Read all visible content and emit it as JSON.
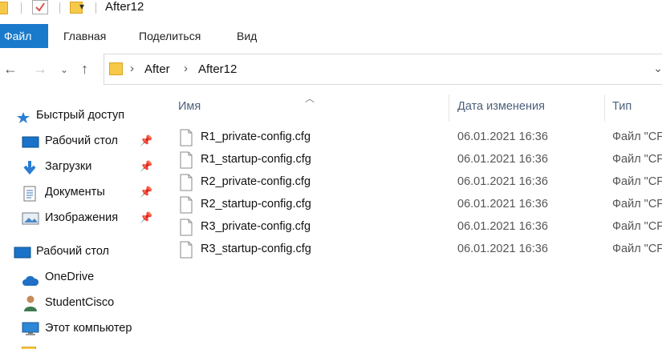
{
  "window": {
    "title": "After12"
  },
  "ribbon": {
    "tabs": [
      "Файл",
      "Главная",
      "Поделиться",
      "Вид"
    ]
  },
  "address": {
    "crumbs": [
      "After",
      "After12"
    ]
  },
  "sidebar": {
    "quick_access": "Быстрый доступ",
    "pinned": [
      {
        "label": "Рабочий стол",
        "icon": "desktop-icon"
      },
      {
        "label": "Загрузки",
        "icon": "download-icon"
      },
      {
        "label": "Документы",
        "icon": "documents-icon"
      },
      {
        "label": "Изображения",
        "icon": "pictures-icon"
      }
    ],
    "desktop": "Рабочий стол",
    "onedrive": "OneDrive",
    "user": "StudentCisco",
    "computer": "Этот компьютер"
  },
  "columns": {
    "name": "Имя",
    "date": "Дата изменения",
    "type": "Тип"
  },
  "files": [
    {
      "name": "R1_private-config.cfg",
      "date": "06.01.2021 16:36",
      "type": "Файл \"CF"
    },
    {
      "name": "R1_startup-config.cfg",
      "date": "06.01.2021 16:36",
      "type": "Файл \"CF"
    },
    {
      "name": "R2_private-config.cfg",
      "date": "06.01.2021 16:36",
      "type": "Файл \"CF"
    },
    {
      "name": "R2_startup-config.cfg",
      "date": "06.01.2021 16:36",
      "type": "Файл \"CF"
    },
    {
      "name": "R3_private-config.cfg",
      "date": "06.01.2021 16:36",
      "type": "Файл \"CF"
    },
    {
      "name": "R3_startup-config.cfg",
      "date": "06.01.2021 16:36",
      "type": "Файл \"CF"
    }
  ]
}
